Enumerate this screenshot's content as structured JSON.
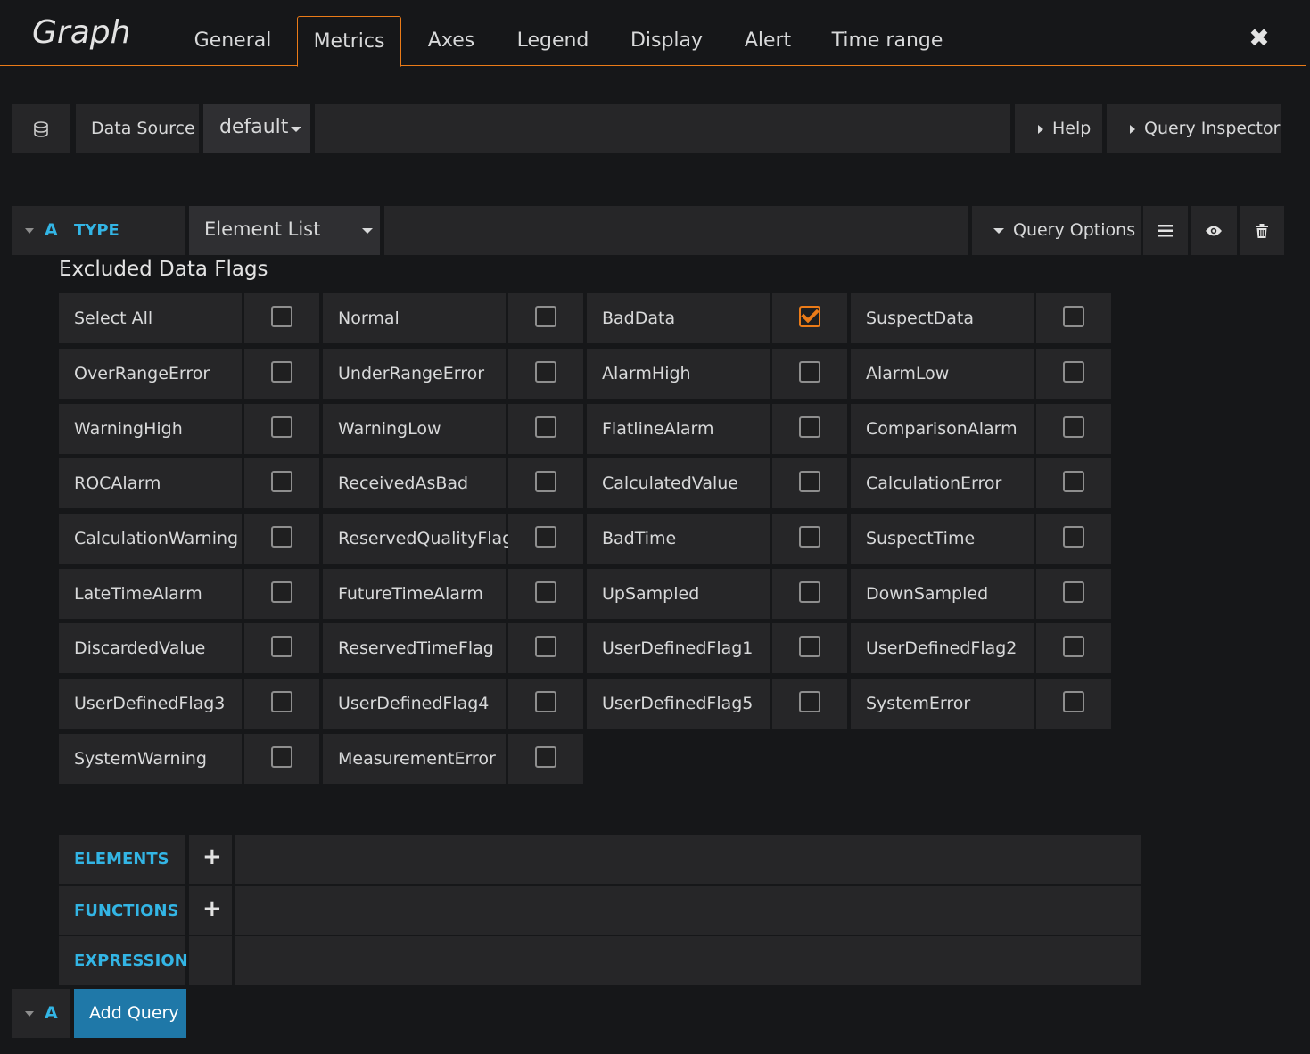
{
  "header": {
    "title": "Graph",
    "tabs": [
      "General",
      "Metrics",
      "Axes",
      "Legend",
      "Display",
      "Alert",
      "Time range"
    ],
    "active_tab": "Metrics",
    "close_glyph": "✖"
  },
  "datasource": {
    "icon": "database-icon",
    "label": "Data Source",
    "value": "default",
    "help": "Help",
    "inspector": "Query Inspector"
  },
  "query": {
    "letter": "A",
    "type_label": "TYPE",
    "type_value": "Element List",
    "options_label": "Query Options",
    "section_title": "Excluded Data Flags",
    "flags": [
      {
        "label": "Select All",
        "checked": false
      },
      {
        "label": "Normal",
        "checked": false
      },
      {
        "label": "BadData",
        "checked": true
      },
      {
        "label": "SuspectData",
        "checked": false
      },
      {
        "label": "OverRangeError",
        "checked": false
      },
      {
        "label": "UnderRangeError",
        "checked": false
      },
      {
        "label": "AlarmHigh",
        "checked": false
      },
      {
        "label": "AlarmLow",
        "checked": false
      },
      {
        "label": "WarningHigh",
        "checked": false
      },
      {
        "label": "WarningLow",
        "checked": false
      },
      {
        "label": "FlatlineAlarm",
        "checked": false
      },
      {
        "label": "ComparisonAlarm",
        "checked": false
      },
      {
        "label": "ROCAlarm",
        "checked": false
      },
      {
        "label": "ReceivedAsBad",
        "checked": false
      },
      {
        "label": "CalculatedValue",
        "checked": false
      },
      {
        "label": "CalculationError",
        "checked": false
      },
      {
        "label": "CalculationWarning",
        "checked": false
      },
      {
        "label": "ReservedQualityFlag",
        "checked": false
      },
      {
        "label": "BadTime",
        "checked": false
      },
      {
        "label": "SuspectTime",
        "checked": false
      },
      {
        "label": "LateTimeAlarm",
        "checked": false
      },
      {
        "label": "FutureTimeAlarm",
        "checked": false
      },
      {
        "label": "UpSampled",
        "checked": false
      },
      {
        "label": "DownSampled",
        "checked": false
      },
      {
        "label": "DiscardedValue",
        "checked": false
      },
      {
        "label": "ReservedTimeFlag",
        "checked": false
      },
      {
        "label": "UserDefinedFlag1",
        "checked": false
      },
      {
        "label": "UserDefinedFlag2",
        "checked": false
      },
      {
        "label": "UserDefinedFlag3",
        "checked": false
      },
      {
        "label": "UserDefinedFlag4",
        "checked": false
      },
      {
        "label": "UserDefinedFlag5",
        "checked": false
      },
      {
        "label": "SystemError",
        "checked": false
      },
      {
        "label": "SystemWarning",
        "checked": false
      },
      {
        "label": "MeasurementError",
        "checked": false
      }
    ],
    "elements_label": "ELEMENTS",
    "functions_label": "FUNCTIONS",
    "expression_label": "EXPRESSION",
    "plus_glyph": "+"
  },
  "footer": {
    "letter": "A",
    "add_query": "Add Query"
  },
  "colors": {
    "accent": "#eb7b18",
    "blue": "#33b5e5",
    "button_blue": "#1f78a8",
    "panel": "#262628",
    "bg": "#161719"
  }
}
